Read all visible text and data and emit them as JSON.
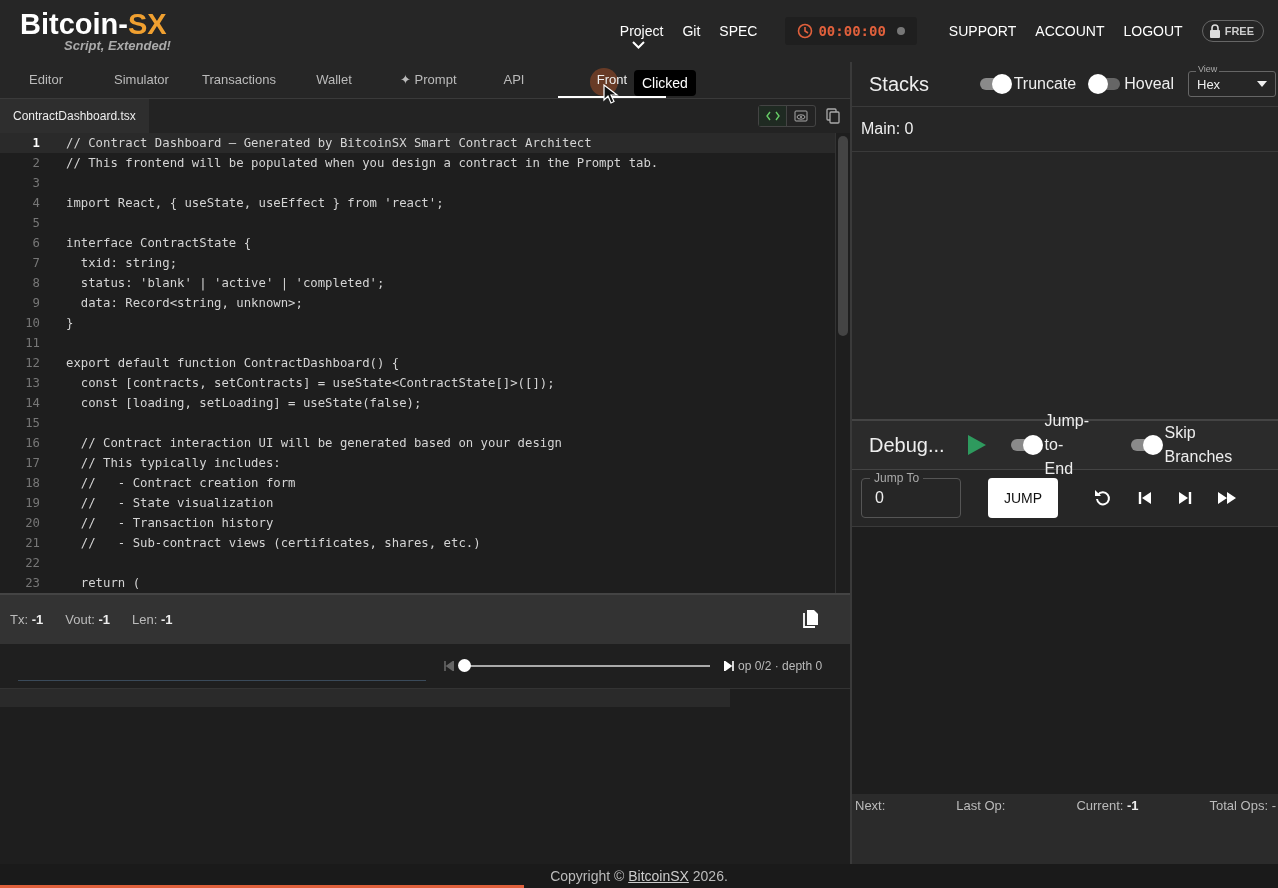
{
  "header": {
    "logo_main": "Bitcoin-",
    "logo_accent": "SX",
    "tagline": "Script, Extended!",
    "nav_left": [
      "Project",
      "Git",
      "SPEC"
    ],
    "timer": "00:00:00",
    "nav_right": [
      "SUPPORT",
      "ACCOUNT",
      "LOGOUT"
    ],
    "plan_badge": "FREE"
  },
  "tabs": [
    {
      "label": "Editor",
      "selected": false
    },
    {
      "label": "Simulator",
      "selected": false
    },
    {
      "label": "Transactions",
      "selected": false
    },
    {
      "label": "Wallet",
      "selected": false
    },
    {
      "label": "✦ Prompt",
      "selected": false
    },
    {
      "label": "API",
      "selected": false
    },
    {
      "label": "Front",
      "selected": true
    }
  ],
  "click_tooltip": "Clicked",
  "file_tab": {
    "label": "ContractDashboard.tsx",
    "selected": true
  },
  "editor": {
    "lines": [
      {
        "number": "1",
        "current": true,
        "text": "// Contract Dashboard — Generated by BitcoinSX Smart Contract Architect"
      },
      {
        "number": "2",
        "current": false,
        "text": "// This frontend will be populated when you design a contract in the Prompt tab."
      },
      {
        "number": "3",
        "current": false
      },
      {
        "number": "4",
        "current": false,
        "text": "import React, { useState, useEffect } from 'react';"
      },
      {
        "number": "5",
        "current": false
      },
      {
        "number": "6",
        "current": false,
        "text": "interface ContractState {"
      },
      {
        "number": "7",
        "current": false,
        "text": "  txid: string;"
      },
      {
        "number": "8",
        "current": false,
        "text": "  status: 'blank' | 'active' | 'completed';"
      },
      {
        "number": "9",
        "current": false,
        "text": "  data: Record<string, unknown>;"
      },
      {
        "number": "10",
        "current": false,
        "text": "}"
      },
      {
        "number": "11",
        "current": false
      },
      {
        "number": "12",
        "current": false,
        "text": "export default function ContractDashboard() {"
      },
      {
        "number": "13",
        "current": false,
        "text": "  const [contracts, setContracts] = useState<ContractState[]>([]);"
      },
      {
        "number": "14",
        "current": false,
        "text": "  const [loading, setLoading] = useState(false);"
      },
      {
        "number": "15",
        "current": false
      },
      {
        "number": "16",
        "current": false,
        "text": "  // Contract interaction UI will be generated based on your design"
      },
      {
        "number": "17",
        "current": false,
        "text": "  // This typically includes:"
      },
      {
        "number": "18",
        "current": false,
        "text": "  //   - Contract creation form"
      },
      {
        "number": "19",
        "current": false,
        "text": "  //   - State visualization"
      },
      {
        "number": "20",
        "current": false,
        "text": "  //   - Transaction history"
      },
      {
        "number": "21",
        "current": false,
        "text": "  //   - Sub-contract views (certificates, shares, etc.)"
      },
      {
        "number": "22",
        "current": false
      },
      {
        "number": "23",
        "current": false,
        "text": "  return ("
      }
    ]
  },
  "tx_info": [
    "Tx: **-1**",
    "Vout: **-1**",
    "Len: **-1**"
  ],
  "step_slider": {
    "level": 0,
    "reading": "op 0/2 · depth 0"
  },
  "stacks": {
    "title": "Stacks",
    "toggles": [
      {
        "label": "Truncate",
        "on": true
      },
      {
        "label": "Hoveal",
        "on": false
      }
    ],
    "view_select": {
      "label": "View",
      "value": "Hex"
    },
    "main": "Main: 0"
  },
  "debug": {
    "title": "Debug...",
    "toggles": [
      {
        "label": "Jump-to-End",
        "on": true
      },
      {
        "label": "Skip Branches",
        "on": true
      }
    ],
    "jump_field": {
      "label": "Jump To",
      "value": "0"
    },
    "jump_button": "JUMP"
  },
  "stats": [
    "Next:",
    "Last Op:",
    "Current: **-1**",
    "Total Ops: -"
  ],
  "footer": {
    "before": "Copyright © ",
    "link": "BitcoinSX",
    "after": " 2026."
  },
  "page_progress": {
    "level": 0.41
  }
}
